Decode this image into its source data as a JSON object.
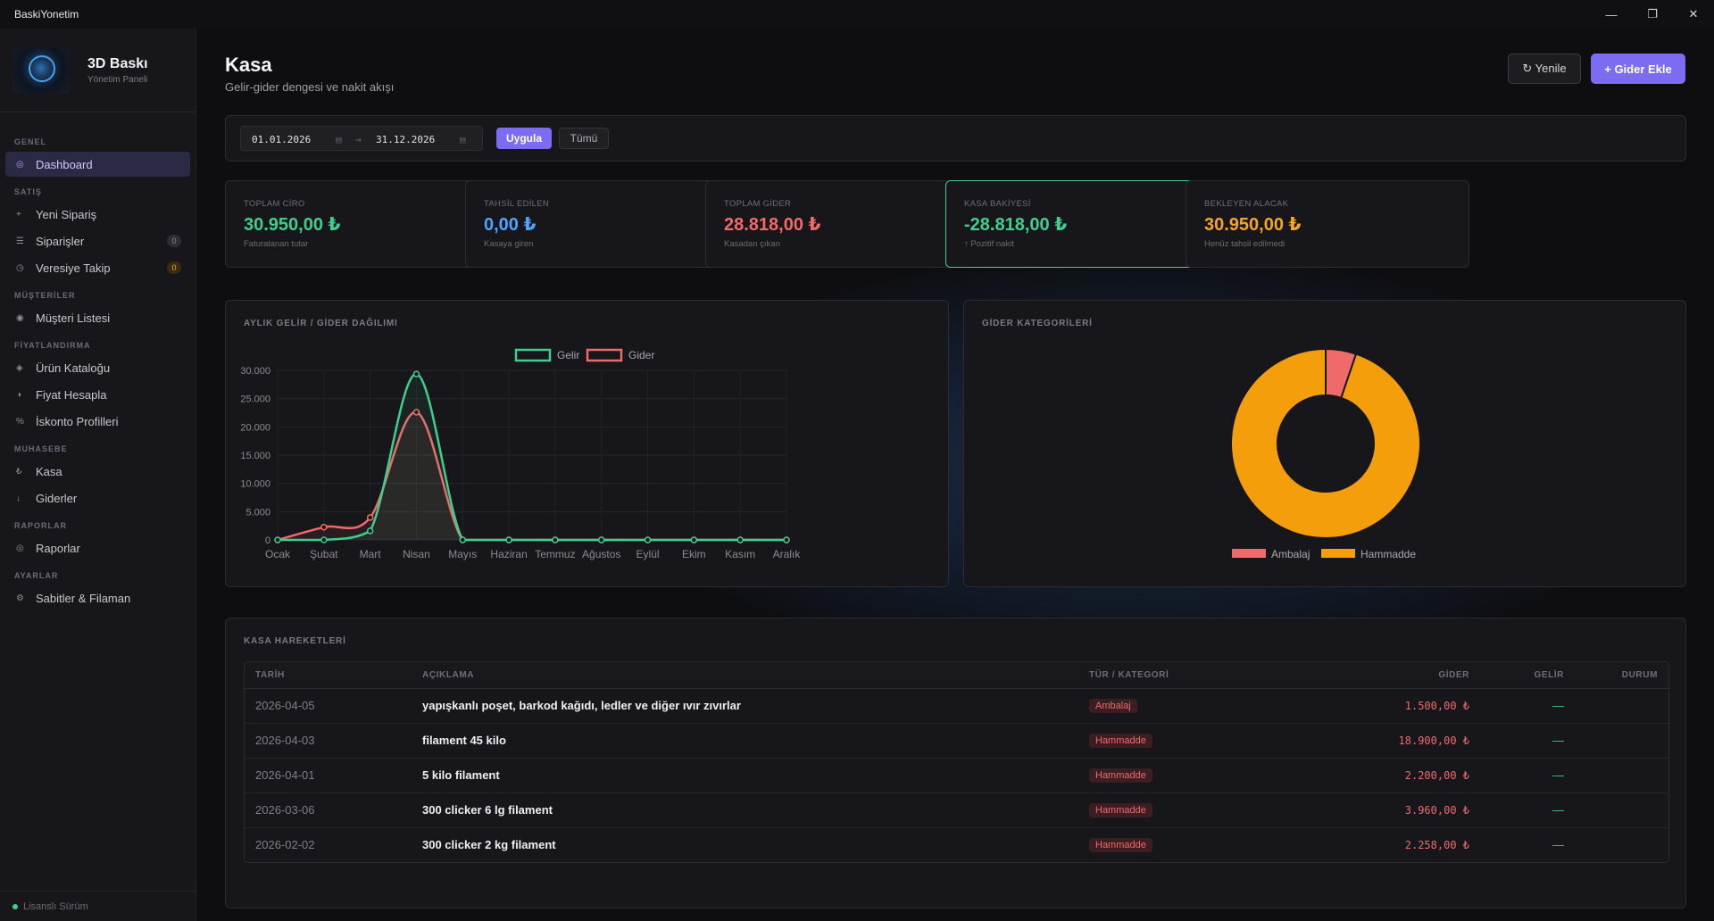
{
  "window": {
    "title": "BaskiYonetim",
    "min": "—",
    "max": "❐",
    "close": "✕"
  },
  "brand": {
    "name": "3D Baskı",
    "sub": "Yönetim Paneli"
  },
  "nav": [
    {
      "section": "GENEL",
      "items": [
        {
          "label": "Dashboard",
          "icon": "◎",
          "active": true
        }
      ]
    },
    {
      "section": "SATIŞ",
      "items": [
        {
          "label": "Yeni Sipariş",
          "icon": "+"
        },
        {
          "label": "Siparişler",
          "icon": "☰",
          "badge": "0"
        },
        {
          "label": "Veresiye Takip",
          "icon": "◷",
          "badge": "0",
          "badge_color": "orange"
        }
      ]
    },
    {
      "section": "MÜŞTERİLER",
      "items": [
        {
          "label": "Müşteri Listesi",
          "icon": "◉"
        }
      ]
    },
    {
      "section": "FİYATLANDIRMA",
      "items": [
        {
          "label": "Ürün Kataloğu",
          "icon": "◈"
        },
        {
          "label": "Fiyat Hesapla",
          "icon": "◑"
        },
        {
          "label": "İskonto Profilleri",
          "icon": "%"
        }
      ]
    },
    {
      "section": "MUHASEBE",
      "items": [
        {
          "label": "Kasa",
          "icon": "₺"
        },
        {
          "label": "Giderler",
          "icon": "↓"
        }
      ]
    },
    {
      "section": "RAPORLAR",
      "items": [
        {
          "label": "Raporlar",
          "icon": "◎"
        }
      ]
    },
    {
      "section": "AYARLAR",
      "items": [
        {
          "label": "Sabitler & Filaman",
          "icon": "⚙"
        }
      ]
    }
  ],
  "license": "Lisanslı Sürüm",
  "page": {
    "title": "Kasa",
    "subtitle": "Gelir-gider dengesi ve nakit akışı",
    "refresh": "↻ Yenile",
    "add": "+ Gider Ekle"
  },
  "filter": {
    "from": "01.01.2026",
    "to": "31.12.2026",
    "arrow": "→",
    "cal_icon": "▤",
    "apply": "Uygula",
    "all": "Tümü"
  },
  "stats": [
    {
      "label": "TOPLAM CİRO",
      "value": "30.950,00 ₺",
      "sub": "Faturalanan tutar",
      "color": "#3ecf8e"
    },
    {
      "label": "TAHSİL EDİLEN",
      "value": "0,00 ₺",
      "sub": "Kasaya giren",
      "color": "#4da3ff"
    },
    {
      "label": "TOPLAM GİDER",
      "value": "28.818,00 ₺",
      "sub": "Kasadan çıkan",
      "color": "#f06a6a"
    },
    {
      "label": "KASA BAKİYESİ",
      "value": "-28.818,00 ₺",
      "sub": "↑ Pozitif nakit",
      "color": "#3ecf8e"
    },
    {
      "label": "BEKLEYEN ALACAK",
      "value": "30.950,00 ₺",
      "sub": "Henüz tahsil edilmedi",
      "color": "#f5a524"
    }
  ],
  "chart_title": "AYLIK GELİR / GİDER DAĞILIMI",
  "pie_title": "GİDER KATEGORİLERİ",
  "chart_data": [
    {
      "type": "line",
      "categories": [
        "Ocak",
        "Şubat",
        "Mart",
        "Nisan",
        "Mayıs",
        "Haziran",
        "Temmuz",
        "Ağustos",
        "Eylül",
        "Ekim",
        "Kasım",
        "Aralık"
      ],
      "series": [
        {
          "name": "Gelir",
          "color": "#3ecf8e",
          "values": [
            0,
            0,
            1600,
            29350,
            0,
            0,
            0,
            0,
            0,
            0,
            0,
            0
          ]
        },
        {
          "name": "Gider",
          "color": "#f06a6a",
          "values": [
            0,
            2258,
            3960,
            22600,
            0,
            0,
            0,
            0,
            0,
            0,
            0,
            0
          ]
        }
      ],
      "yticks": [
        "0",
        "5.000",
        "10.000",
        "15.000",
        "20.000",
        "25.000",
        "30.000"
      ],
      "ylim": [
        0,
        30000
      ],
      "legend": "top"
    },
    {
      "type": "pie",
      "labels": [
        "Ambalaj",
        "Hammadde"
      ],
      "values": [
        1500,
        27318
      ],
      "colors": [
        "#f06a6a",
        "#f59e0b"
      ],
      "legend": "bottom"
    }
  ],
  "table": {
    "title": "KASA HAREKETLERİ",
    "headers": [
      "TARİH",
      "AÇIKLAMA",
      "TÜR / KATEGORİ",
      "GİDER",
      "GELİR",
      "DURUM"
    ],
    "rows": [
      {
        "date": "2026-04-05",
        "desc": "yapışkanlı poşet, barkod kağıdı, ledler ve diğer ıvır zıvırlar",
        "cat": "Ambalaj",
        "gider": "1.500,00 ₺",
        "gelir": "—"
      },
      {
        "date": "2026-04-03",
        "desc": "filament 45 kilo",
        "cat": "Hammadde",
        "gider": "18.900,00 ₺",
        "gelir": "—"
      },
      {
        "date": "2026-04-01",
        "desc": "5 kilo filament",
        "cat": "Hammadde",
        "gider": "2.200,00 ₺",
        "gelir": "—"
      },
      {
        "date": "2026-03-06",
        "desc": "300 clicker 6 lg filament",
        "cat": "Hammadde",
        "gider": "3.960,00 ₺",
        "gelir": "—"
      },
      {
        "date": "2026-02-02",
        "desc": "300 clicker 2 kg filament",
        "cat": "Hammadde",
        "gider": "2.258,00 ₺",
        "gelir": "—"
      }
    ]
  }
}
